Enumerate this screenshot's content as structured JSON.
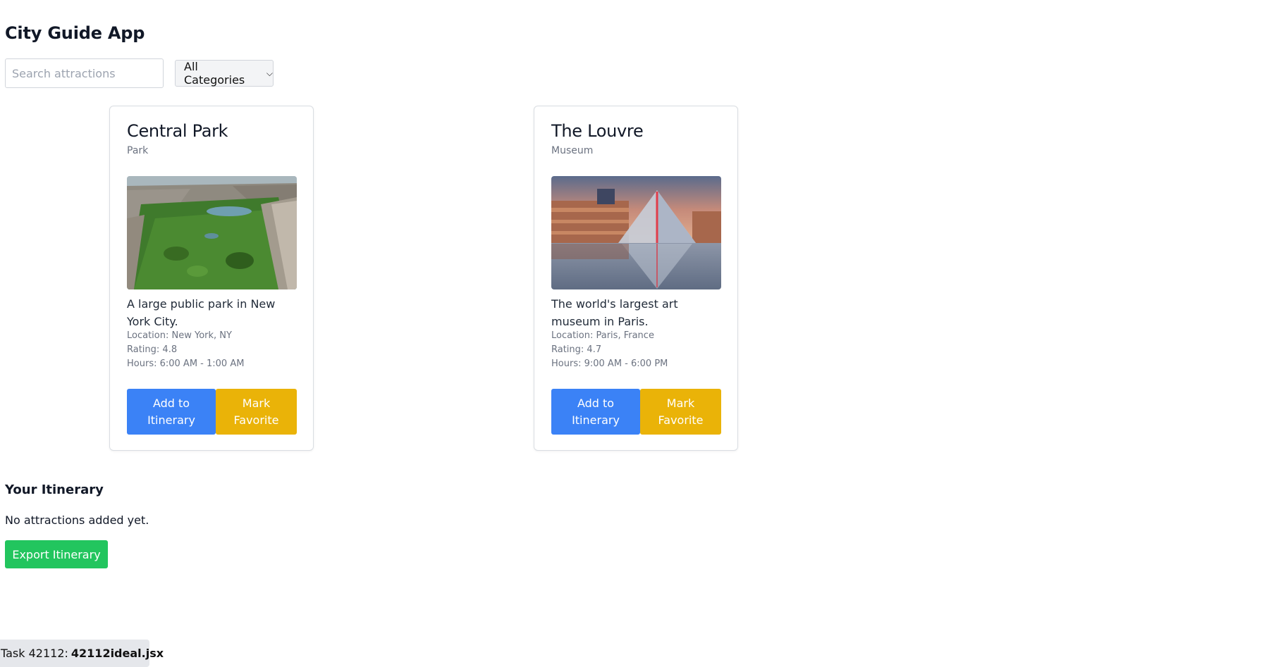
{
  "app": {
    "title": "City Guide App"
  },
  "filters": {
    "search_placeholder": "Search attractions",
    "category_selected": "All Categories"
  },
  "attractions": [
    {
      "name": "Central Park",
      "category": "Park",
      "image_alt": "Central Park",
      "description": "A large public park in New York City.",
      "location": "Location: New York, NY",
      "rating": "Rating: 4.8",
      "hours": "Hours: 6:00 AM - 1:00 AM",
      "add_label": "Add to Itinerary",
      "favorite_label": "Mark Favorite"
    },
    {
      "name": "The Louvre",
      "category": "Museum",
      "image_alt": "The Louvre",
      "description": "The world's largest art museum in Paris.",
      "location": "Location: Paris, France",
      "rating": "Rating: 4.7",
      "hours": "Hours: 9:00 AM - 6:00 PM",
      "add_label": "Add to Itinerary",
      "favorite_label": "Mark Favorite"
    }
  ],
  "itinerary": {
    "title": "Your Itinerary",
    "empty_message": "No attractions added yet.",
    "export_label": "Export Itinerary"
  },
  "task": {
    "prefix": "Task 42112:",
    "file": "42112ideal.jsx"
  },
  "colors": {
    "primary_blue": "#3b82f6",
    "favorite_yellow": "#eab308",
    "export_green": "#22c55e"
  }
}
